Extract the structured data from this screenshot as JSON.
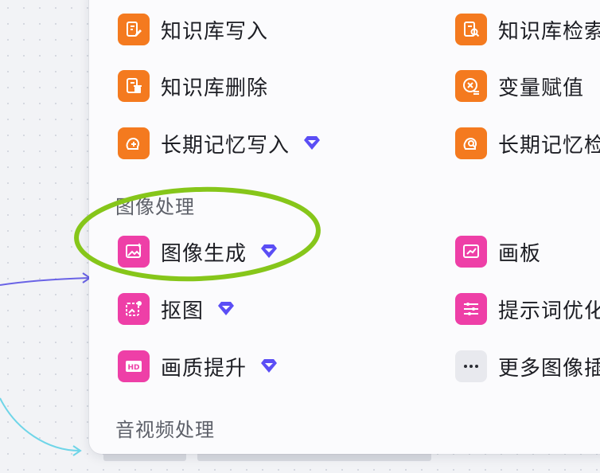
{
  "menu": {
    "knowledge_items": [
      {
        "label": "知识库写入",
        "icon": "knowledge-write-icon",
        "premium": false
      },
      {
        "label": "知识库检索",
        "icon": "knowledge-search-icon",
        "premium": false
      },
      {
        "label": "知识库删除",
        "icon": "knowledge-delete-icon",
        "premium": false
      },
      {
        "label": "变量赋值",
        "icon": "variable-assign-icon",
        "premium": false
      },
      {
        "label": "长期记忆写入",
        "icon": "memory-write-icon",
        "premium": true
      },
      {
        "label": "长期记忆检索",
        "icon": "memory-search-icon",
        "premium": false
      }
    ],
    "image_section_title": "图像处理",
    "image_items": [
      {
        "label": "图像生成",
        "icon": "image-generate-icon",
        "premium": true
      },
      {
        "label": "画板",
        "icon": "canvas-board-icon",
        "premium": false
      },
      {
        "label": "抠图",
        "icon": "cutout-icon",
        "premium": true
      },
      {
        "label": "提示词优化",
        "icon": "prompt-optimize-icon",
        "premium": false
      },
      {
        "label": "画质提升",
        "icon": "hd-upscale-icon",
        "premium": true
      },
      {
        "label": "更多图像插件",
        "icon": "more-dots-icon",
        "premium": false
      }
    ],
    "av_section_title": "音视频处理"
  },
  "colors": {
    "orange": "#f47a1f",
    "pink": "#ee3fa7",
    "premium_gem": "#5b4ef5",
    "highlight_ring": "#86c61a",
    "connector_top": "#6a63e6",
    "connector_bottom": "#6fd5e8"
  }
}
